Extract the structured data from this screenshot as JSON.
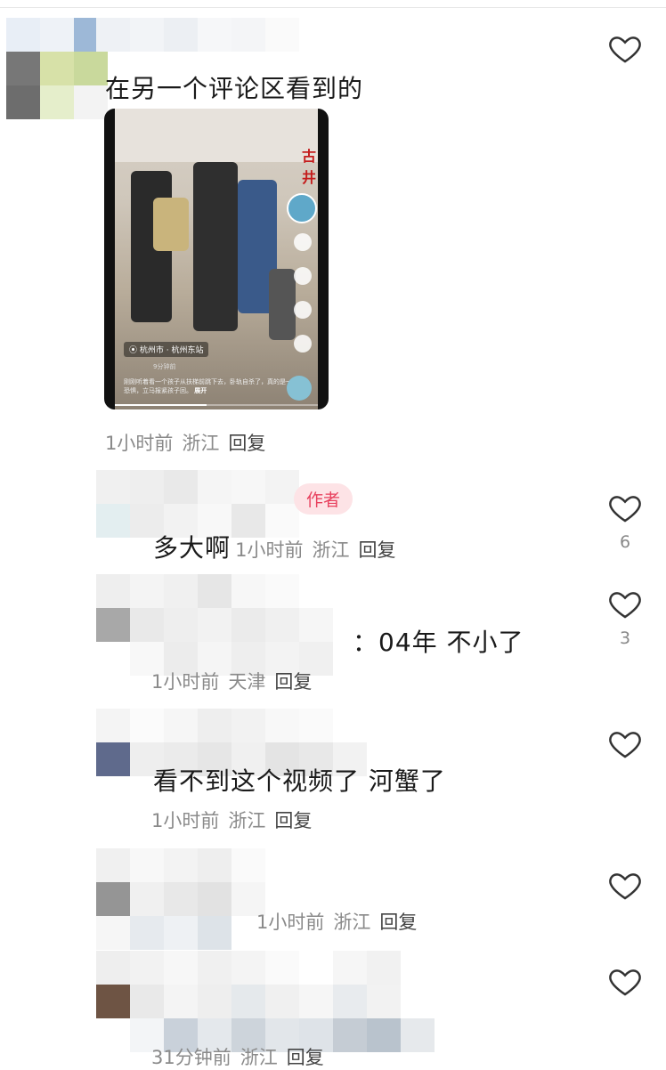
{
  "comments": [
    {
      "text": "在另一个评论区看到的",
      "video": {
        "location": "杭州市 · 杭州东站",
        "time_ago": "9分钟前",
        "caption": "刚刚听着看一个孩子从扶梯前跳下去，卧轨自杀了，真的是一种恐惧，立马报紧孩子回。",
        "expand": "展开",
        "sign": "古井",
        "progress": 0.45
      },
      "time": "1小时前",
      "region": "浙江",
      "reply": "回复",
      "likes": ""
    },
    {
      "badge": "作者",
      "text": "多大啊",
      "time": "1小时前",
      "region": "浙江",
      "reply": "回复",
      "likes": "6"
    },
    {
      "text": "：04年 不小了",
      "time": "1小时前",
      "region": "天津",
      "reply": "回复",
      "likes": "3"
    },
    {
      "text": "看不到这个视频了 河蟹了",
      "time": "1小时前",
      "region": "浙江",
      "reply": "回复",
      "likes": ""
    },
    {
      "text": "",
      "time": "1小时前",
      "region": "浙江",
      "reply": "回复",
      "likes": ""
    },
    {
      "text": "",
      "time": "31分钟前",
      "region": "浙江",
      "reply": "回复",
      "likes": ""
    }
  ],
  "icons": {
    "like": "heart-outline-icon",
    "location": "location-pin-icon"
  },
  "colors": {
    "author_badge_bg": "#fde3e6",
    "author_badge_text": "#e8415e",
    "meta_text": "#8a8a8a"
  }
}
